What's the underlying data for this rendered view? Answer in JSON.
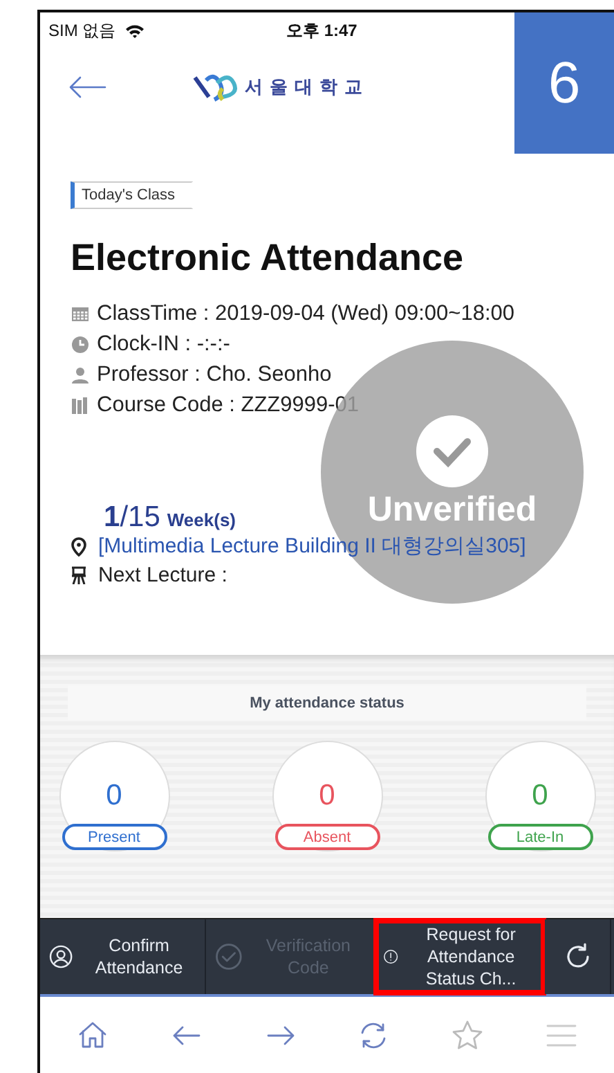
{
  "step_badge": "6",
  "status_bar": {
    "carrier": "SIM 없음",
    "time": "오후 1:47"
  },
  "header": {
    "logo_text": "서울대학교"
  },
  "tag": "Today's Class",
  "title": "Electronic Attendance",
  "info": [
    {
      "kind": "calendar",
      "text": "ClassTime : 2019-09-04 (Wed) 09:00~18:00"
    },
    {
      "kind": "clock",
      "text": "Clock-IN : -:-:-"
    },
    {
      "kind": "person",
      "text": "Professor : Cho. Seonho"
    },
    {
      "kind": "book",
      "text": "Course Code : ZZZ9999-01"
    }
  ],
  "week": {
    "current": "1",
    "total": "/15",
    "unit": "Week(s)"
  },
  "location": "[Multimedia Lecture Building II 대형강의실305]",
  "next_lecture": "Next Lecture :",
  "verification": {
    "label": "Unverified",
    "verified": false
  },
  "status_panel": {
    "title": "My attendance status",
    "counts": [
      {
        "value": "0",
        "label": "Present",
        "color": "#2f6fcf"
      },
      {
        "value": "0",
        "label": "Absent",
        "color": "#e8545e"
      },
      {
        "value": "0",
        "label": "Late-In",
        "color": "#3fa34d"
      }
    ]
  },
  "actions": [
    {
      "kind": "user",
      "label": "Confirm Attendance",
      "disabled": false,
      "highlighted": false
    },
    {
      "kind": "check",
      "label": "Verification Code",
      "disabled": true,
      "highlighted": false
    },
    {
      "kind": "alert",
      "label": "Request for Attendance Status Ch...",
      "disabled": false,
      "highlighted": true
    },
    {
      "kind": "refresh",
      "disabled": false,
      "highlighted": false
    }
  ],
  "nav": [
    {
      "kind": "home"
    },
    {
      "kind": "back"
    },
    {
      "kind": "forward"
    },
    {
      "kind": "refresh"
    },
    {
      "kind": "star"
    },
    {
      "kind": "menu"
    }
  ]
}
